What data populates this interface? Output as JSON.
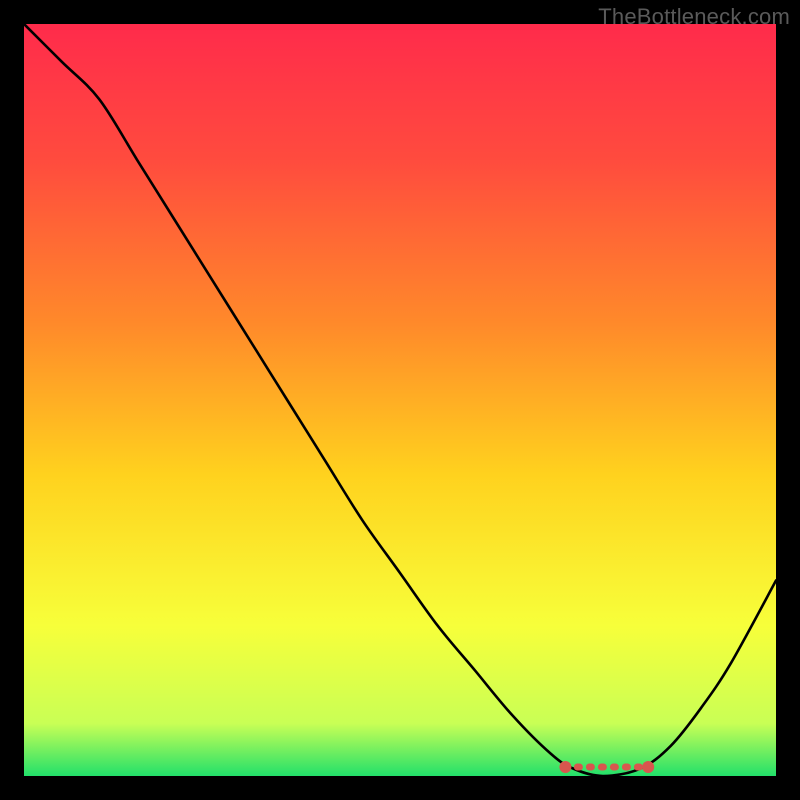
{
  "watermark": "TheBottleneck.com",
  "colors": {
    "curve": "#000000",
    "marker": "#d9564e",
    "gradient_stops": [
      {
        "offset": "0%",
        "color": "#ff2b4b"
      },
      {
        "offset": "18%",
        "color": "#ff4b3e"
      },
      {
        "offset": "40%",
        "color": "#ff8a2a"
      },
      {
        "offset": "60%",
        "color": "#ffd21e"
      },
      {
        "offset": "80%",
        "color": "#f7ff3a"
      },
      {
        "offset": "93%",
        "color": "#c9ff55"
      },
      {
        "offset": "100%",
        "color": "#22e06a"
      }
    ]
  },
  "chart_data": {
    "type": "line",
    "title": "",
    "xlabel": "",
    "ylabel": "",
    "xlim": [
      0,
      100
    ],
    "ylim": [
      0,
      100
    ],
    "y_inverted_note": "y = 0 plotted at bottom (green); curve peaks at top (red) and dips to ~0 in the 72–82 x-range.",
    "series": [
      {
        "name": "bottleneck-curve",
        "x": [
          0,
          5,
          10,
          15,
          20,
          25,
          30,
          35,
          40,
          45,
          50,
          55,
          60,
          65,
          70,
          73,
          77,
          82,
          86,
          90,
          94,
          100
        ],
        "y": [
          100,
          95,
          90,
          82,
          74,
          66,
          58,
          50,
          42,
          34,
          27,
          20,
          14,
          8,
          3,
          1,
          0,
          1,
          4,
          9,
          15,
          26
        ]
      }
    ],
    "optimal_region": {
      "x_start": 72,
      "x_end": 83,
      "y": 1.2
    }
  }
}
